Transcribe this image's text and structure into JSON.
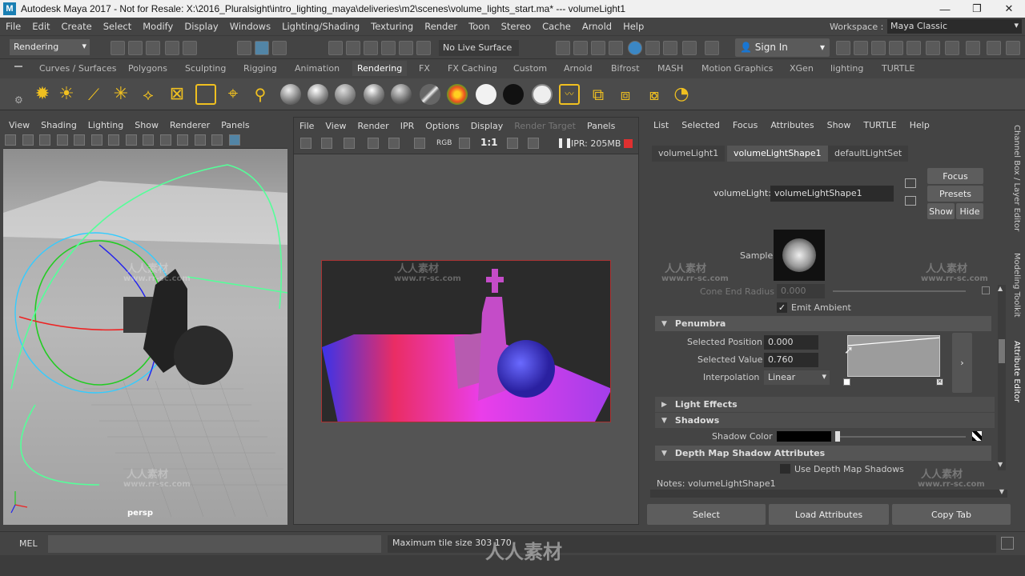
{
  "window": {
    "app_initial": "M",
    "title": "Autodesk Maya 2017 - Not for Resale: X:\\2016_Pluralsight\\intro_lighting_maya\\deliveries\\m2\\scenes\\volume_lights_start.ma*   ---   volumeLight1",
    "minimize": "—",
    "maximize": "❐",
    "close": "✕"
  },
  "menu": [
    "File",
    "Edit",
    "Create",
    "Select",
    "Modify",
    "Display",
    "Windows",
    "Lighting/Shading",
    "Texturing",
    "Render",
    "Toon",
    "Stereo",
    "Cache",
    "Arnold",
    "Help"
  ],
  "workspace": {
    "label": "Workspace :",
    "value": "Maya Classic"
  },
  "toolbar": {
    "menuset": "Rendering",
    "live_surface": "No Live Surface",
    "sign_in": "Sign In"
  },
  "shelf_tabs": [
    "Curves / Surfaces",
    "Polygons",
    "Sculpting",
    "Rigging",
    "Animation",
    "Rendering",
    "FX",
    "FX Caching",
    "Custom",
    "Arnold",
    "Bifrost",
    "MASH",
    "Motion Graphics",
    "XGen",
    "lighting",
    "TURTLE"
  ],
  "shelf_active": "Rendering",
  "persp_menu": [
    "View",
    "Shading",
    "Lighting",
    "Show",
    "Renderer",
    "Panels"
  ],
  "persp_label": "persp",
  "render_menu": [
    "File",
    "View",
    "Render",
    "IPR",
    "Options",
    "Display",
    "Render Target",
    "Panels"
  ],
  "render_toolbar": {
    "rgb": "RGB",
    "ratio": "1:1",
    "ipr": "IPR: 205MB"
  },
  "ae_menu": [
    "List",
    "Selected",
    "Focus",
    "Attributes",
    "Show",
    "TURTLE",
    "Help"
  ],
  "ae_tabs": [
    "volumeLight1",
    "volumeLightShape1",
    "defaultLightSet"
  ],
  "ae": {
    "node_label": "volumeLight:",
    "node_value": "volumeLightShape1",
    "focus": "Focus",
    "presets": "Presets",
    "show": "Show",
    "hide": "Hide",
    "sample": "Sample",
    "cone_end_radius_label": "Cone End Radius",
    "cone_end_radius": "0.000",
    "emit_ambient": "Emit Ambient",
    "penumbra": "Penumbra",
    "selected_position_label": "Selected Position",
    "selected_position": "0.000",
    "selected_value_label": "Selected Value",
    "selected_value": "0.760",
    "interpolation_label": "Interpolation",
    "interpolation": "Linear",
    "light_effects": "Light Effects",
    "shadows": "Shadows",
    "shadow_color": "Shadow Color",
    "depth_map": "Depth Map Shadow Attributes",
    "use_depth_map": "Use Depth Map Shadows",
    "notes": "Notes: volumeLightShape1",
    "select": "Select",
    "load_attributes": "Load Attributes",
    "copy_tab": "Copy Tab"
  },
  "side_tabs": [
    "Channel Box / Layer Editor",
    "Modeling Toolkit",
    "Attribute Editor"
  ],
  "status": {
    "mel": "MEL",
    "message": "Maximum tile size 303 170"
  },
  "watermarks": [
    "人人素材",
    "www.rr-sc.com"
  ],
  "colors": {
    "accent": "#5285a6",
    "render_border": "#aa3333"
  }
}
